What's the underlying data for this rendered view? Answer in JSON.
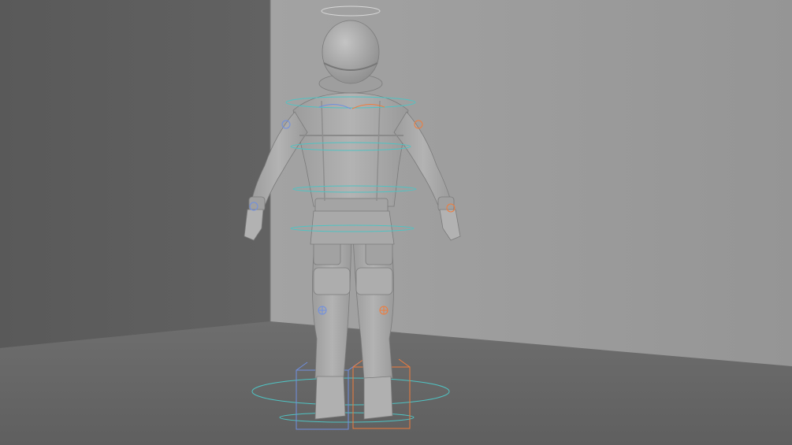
{
  "viewport": {
    "kind": "3d-viewport",
    "model": "astronaut-character",
    "pose": "a-pose",
    "shading": "clay-grey",
    "rig_overlay": "visible",
    "colors": {
      "left_wall": "#5c5c5c",
      "back_wall": "#9a9a9a",
      "floor": "#646464",
      "suit": "#a7a7a7",
      "rig_center": "#4fc3c3",
      "rig_left": "#f07c3c",
      "rig_right": "#6f8fe0",
      "halo": "#d8d8d8"
    }
  }
}
